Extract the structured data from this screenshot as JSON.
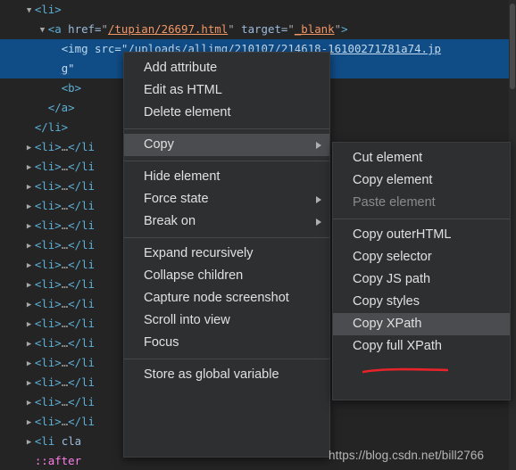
{
  "tree": {
    "rows": [
      {
        "indent": 2,
        "twisty": "down",
        "segments": [
          {
            "t": "tag",
            "v": "<li>"
          }
        ],
        "selected": false
      },
      {
        "indent": 3,
        "twisty": "down",
        "segments": [
          {
            "t": "tag",
            "v": "<a "
          },
          {
            "t": "attrname",
            "v": "href="
          },
          {
            "t": "punct",
            "v": "\""
          },
          {
            "t": "link",
            "v": "/tupian/26697.html"
          },
          {
            "t": "punct",
            "v": "\" "
          },
          {
            "t": "attrname",
            "v": "target="
          },
          {
            "t": "punct",
            "v": "\""
          },
          {
            "t": "link",
            "v": "_blank"
          },
          {
            "t": "punct",
            "v": "\""
          },
          {
            "t": "tag",
            "v": ">"
          }
        ],
        "selected": false
      },
      {
        "indent": 4,
        "twisty": "none",
        "segments": [
          {
            "t": "tag",
            "v": "<img "
          },
          {
            "t": "attrname",
            "v": "src="
          },
          {
            "t": "punct",
            "v": "\""
          },
          {
            "t": "link",
            "v": "/uploads/allimg/210107/214618-16100271781a74.jp"
          }
        ],
        "selected": true
      },
      {
        "indent": 4,
        "twisty": "none",
        "segments": [
          {
            "t": "link",
            "v": "g"
          },
          {
            "t": "punct",
            "v": "\""
          }
        ],
        "selected": true
      },
      {
        "indent": 4,
        "twisty": "none",
        "segments": [
          {
            "t": "tag",
            "v": "<b>"
          }
        ],
        "selected": false
      },
      {
        "indent": 3,
        "twisty": "none",
        "segments": [
          {
            "t": "tag",
            "v": "</a>"
          }
        ],
        "selected": false
      },
      {
        "indent": 2,
        "twisty": "none",
        "segments": [
          {
            "t": "tag",
            "v": "</li>"
          }
        ],
        "selected": false
      },
      {
        "indent": 2,
        "twisty": "right",
        "segments": [
          {
            "t": "tag",
            "v": "<li>"
          },
          {
            "t": "ellip",
            "v": "…"
          },
          {
            "t": "tag",
            "v": "</"
          },
          {
            "t": "tag",
            "v": "li"
          }
        ],
        "selected": false
      },
      {
        "indent": 2,
        "twisty": "right",
        "segments": [
          {
            "t": "tag",
            "v": "<li>"
          },
          {
            "t": "ellip",
            "v": "…"
          },
          {
            "t": "tag",
            "v": "</"
          },
          {
            "t": "tag",
            "v": "li"
          }
        ],
        "selected": false
      },
      {
        "indent": 2,
        "twisty": "right",
        "segments": [
          {
            "t": "tag",
            "v": "<li>"
          },
          {
            "t": "ellip",
            "v": "…"
          },
          {
            "t": "tag",
            "v": "</"
          },
          {
            "t": "tag",
            "v": "li"
          }
        ],
        "selected": false
      },
      {
        "indent": 2,
        "twisty": "right",
        "segments": [
          {
            "t": "tag",
            "v": "<li>"
          },
          {
            "t": "ellip",
            "v": "…"
          },
          {
            "t": "tag",
            "v": "</"
          },
          {
            "t": "tag",
            "v": "li"
          }
        ],
        "selected": false
      },
      {
        "indent": 2,
        "twisty": "right",
        "segments": [
          {
            "t": "tag",
            "v": "<li>"
          },
          {
            "t": "ellip",
            "v": "…"
          },
          {
            "t": "tag",
            "v": "</"
          },
          {
            "t": "tag",
            "v": "li"
          }
        ],
        "selected": false
      },
      {
        "indent": 2,
        "twisty": "right",
        "segments": [
          {
            "t": "tag",
            "v": "<li>"
          },
          {
            "t": "ellip",
            "v": "…"
          },
          {
            "t": "tag",
            "v": "</"
          },
          {
            "t": "tag",
            "v": "li"
          }
        ],
        "selected": false
      },
      {
        "indent": 2,
        "twisty": "right",
        "segments": [
          {
            "t": "tag",
            "v": "<li>"
          },
          {
            "t": "ellip",
            "v": "…"
          },
          {
            "t": "tag",
            "v": "</"
          },
          {
            "t": "tag",
            "v": "li"
          }
        ],
        "selected": false
      },
      {
        "indent": 2,
        "twisty": "right",
        "segments": [
          {
            "t": "tag",
            "v": "<li>"
          },
          {
            "t": "ellip",
            "v": "…"
          },
          {
            "t": "tag",
            "v": "</"
          },
          {
            "t": "tag",
            "v": "li"
          }
        ],
        "selected": false
      },
      {
        "indent": 2,
        "twisty": "right",
        "segments": [
          {
            "t": "tag",
            "v": "<li>"
          },
          {
            "t": "ellip",
            "v": "…"
          },
          {
            "t": "tag",
            "v": "</"
          },
          {
            "t": "tag",
            "v": "li"
          }
        ],
        "selected": false
      },
      {
        "indent": 2,
        "twisty": "right",
        "segments": [
          {
            "t": "tag",
            "v": "<li>"
          },
          {
            "t": "ellip",
            "v": "…"
          },
          {
            "t": "tag",
            "v": "</"
          },
          {
            "t": "tag",
            "v": "li"
          }
        ],
        "selected": false
      },
      {
        "indent": 2,
        "twisty": "right",
        "segments": [
          {
            "t": "tag",
            "v": "<li>"
          },
          {
            "t": "ellip",
            "v": "…"
          },
          {
            "t": "tag",
            "v": "</"
          },
          {
            "t": "tag",
            "v": "li"
          }
        ],
        "selected": false
      },
      {
        "indent": 2,
        "twisty": "right",
        "segments": [
          {
            "t": "tag",
            "v": "<li>"
          },
          {
            "t": "ellip",
            "v": "…"
          },
          {
            "t": "tag",
            "v": "</"
          },
          {
            "t": "tag",
            "v": "li"
          }
        ],
        "selected": false
      },
      {
        "indent": 2,
        "twisty": "right",
        "segments": [
          {
            "t": "tag",
            "v": "<li>"
          },
          {
            "t": "ellip",
            "v": "…"
          },
          {
            "t": "tag",
            "v": "</"
          },
          {
            "t": "tag",
            "v": "li"
          }
        ],
        "selected": false
      },
      {
        "indent": 2,
        "twisty": "right",
        "segments": [
          {
            "t": "tag",
            "v": "<li>"
          },
          {
            "t": "ellip",
            "v": "…"
          },
          {
            "t": "tag",
            "v": "</"
          },
          {
            "t": "tag",
            "v": "li"
          }
        ],
        "selected": false
      },
      {
        "indent": 2,
        "twisty": "right",
        "segments": [
          {
            "t": "tag",
            "v": "<li>"
          },
          {
            "t": "ellip",
            "v": "…"
          },
          {
            "t": "tag",
            "v": "</"
          },
          {
            "t": "tag",
            "v": "li"
          }
        ],
        "selected": false
      },
      {
        "indent": 2,
        "twisty": "right",
        "segments": [
          {
            "t": "tag",
            "v": "<li "
          },
          {
            "t": "attrname",
            "v": "cla"
          }
        ],
        "selected": false
      },
      {
        "indent": 2,
        "twisty": "none",
        "segments": [
          {
            "t": "pseudo",
            "v": "::after"
          }
        ],
        "selected": false
      }
    ]
  },
  "context_menu": {
    "title": "element-context-menu",
    "items": [
      {
        "label": "Add attribute",
        "type": "item",
        "highlight": false,
        "submenu": false,
        "disabled": false
      },
      {
        "label": "Edit as HTML",
        "type": "item",
        "highlight": false,
        "submenu": false,
        "disabled": false
      },
      {
        "label": "Delete element",
        "type": "item",
        "highlight": false,
        "submenu": false,
        "disabled": false
      },
      {
        "label": "",
        "type": "separator"
      },
      {
        "label": "Copy",
        "type": "item",
        "highlight": true,
        "submenu": true,
        "disabled": false
      },
      {
        "label": "",
        "type": "separator"
      },
      {
        "label": "Hide element",
        "type": "item",
        "highlight": false,
        "submenu": false,
        "disabled": false
      },
      {
        "label": "Force state",
        "type": "item",
        "highlight": false,
        "submenu": true,
        "disabled": false
      },
      {
        "label": "Break on",
        "type": "item",
        "highlight": false,
        "submenu": true,
        "disabled": false
      },
      {
        "label": "",
        "type": "separator"
      },
      {
        "label": "Expand recursively",
        "type": "item",
        "highlight": false,
        "submenu": false,
        "disabled": false
      },
      {
        "label": "Collapse children",
        "type": "item",
        "highlight": false,
        "submenu": false,
        "disabled": false
      },
      {
        "label": "Capture node screenshot",
        "type": "item",
        "highlight": false,
        "submenu": false,
        "disabled": false
      },
      {
        "label": "Scroll into view",
        "type": "item",
        "highlight": false,
        "submenu": false,
        "disabled": false
      },
      {
        "label": "Focus",
        "type": "item",
        "highlight": false,
        "submenu": false,
        "disabled": false
      },
      {
        "label": "",
        "type": "separator"
      },
      {
        "label": "Store as global variable",
        "type": "item",
        "highlight": false,
        "submenu": false,
        "disabled": false
      }
    ]
  },
  "copy_submenu": {
    "title": "copy-submenu",
    "items": [
      {
        "label": "Cut element",
        "type": "item",
        "highlight": false,
        "disabled": false
      },
      {
        "label": "Copy element",
        "type": "item",
        "highlight": false,
        "disabled": false
      },
      {
        "label": "Paste element",
        "type": "item",
        "highlight": false,
        "disabled": true
      },
      {
        "label": "",
        "type": "separator"
      },
      {
        "label": "Copy outerHTML",
        "type": "item",
        "highlight": false,
        "disabled": false
      },
      {
        "label": "Copy selector",
        "type": "item",
        "highlight": false,
        "disabled": false
      },
      {
        "label": "Copy JS path",
        "type": "item",
        "highlight": false,
        "disabled": false
      },
      {
        "label": "Copy styles",
        "type": "item",
        "highlight": false,
        "disabled": false
      },
      {
        "label": "Copy XPath",
        "type": "item",
        "highlight": true,
        "disabled": false
      },
      {
        "label": "Copy full XPath",
        "type": "item",
        "highlight": false,
        "disabled": false
      }
    ]
  },
  "annotation": {
    "type": "red-underline",
    "target": "Copy XPath",
    "color": "#e8232a"
  },
  "watermark": {
    "text": "https://blog.csdn.net/bill2766"
  },
  "colors": {
    "background": "#242424",
    "selection": "#104d87",
    "menu_background": "#2e2f31",
    "menu_highlight": "#4b4c4f",
    "tag": "#5db0d7",
    "attr_value": "#f29766",
    "pseudo": "#ff7de9",
    "text": "#d8d8d8"
  }
}
